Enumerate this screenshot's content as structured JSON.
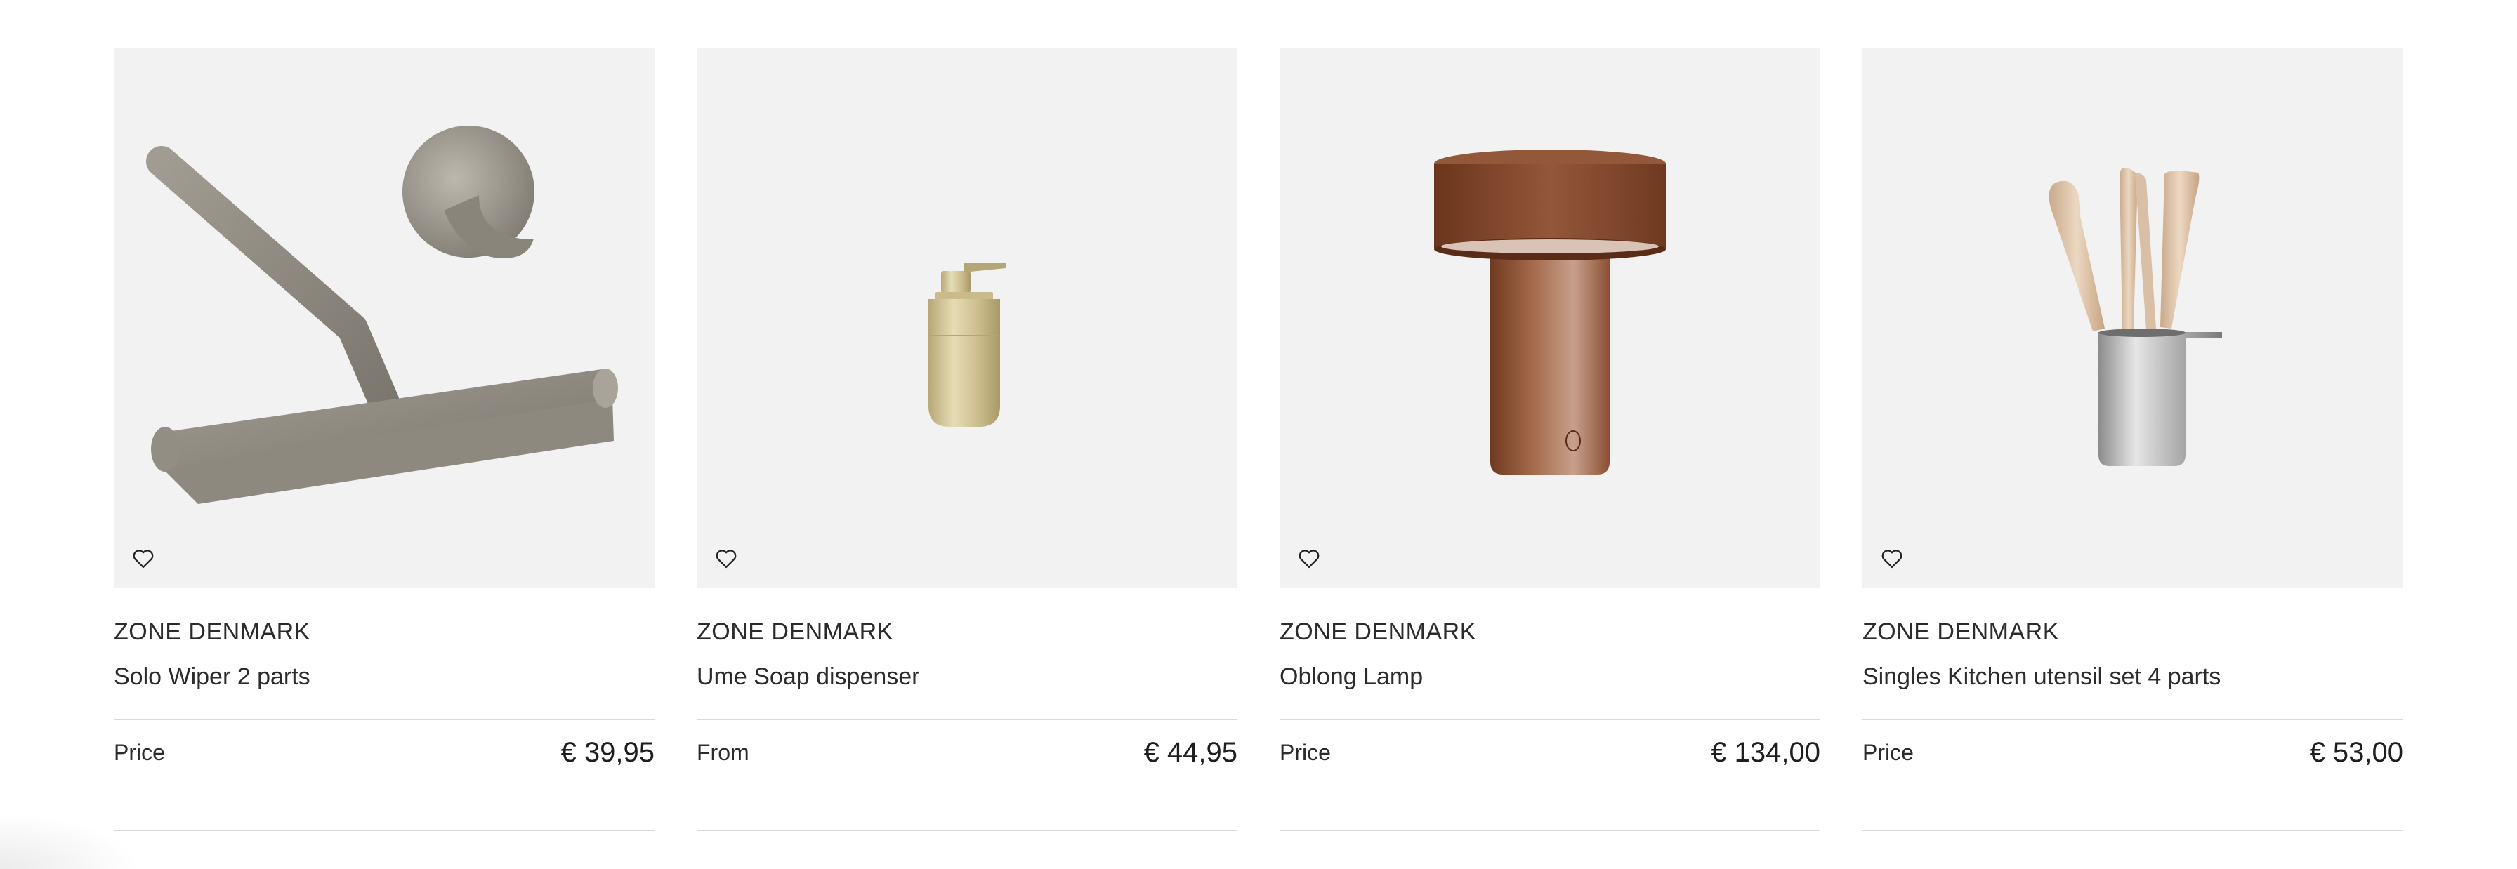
{
  "products": [
    {
      "brand": "ZONE DENMARK",
      "name": "Solo Wiper 2 parts",
      "price_label": "Price",
      "price": "€ 39,95",
      "image_icon": "squeegee-and-hook-image"
    },
    {
      "brand": "ZONE DENMARK",
      "name": "Ume Soap dispenser",
      "price_label": "From",
      "price": "€ 44,95",
      "image_icon": "soap-dispenser-image"
    },
    {
      "brand": "ZONE DENMARK",
      "name": "Oblong Lamp",
      "price_label": "Price",
      "price": "€ 134,00",
      "image_icon": "table-lamp-image"
    },
    {
      "brand": "ZONE DENMARK",
      "name": "Singles Kitchen utensil set 4 parts",
      "price_label": "Price",
      "price": "€ 53,00",
      "image_icon": "kitchen-utensil-set-image"
    }
  ],
  "colors": {
    "image_background": "#f2f2f2",
    "divider": "#d9d9d9",
    "text": "#2b2b2b"
  },
  "icons": {
    "wishlist": "heart-outline-icon"
  }
}
